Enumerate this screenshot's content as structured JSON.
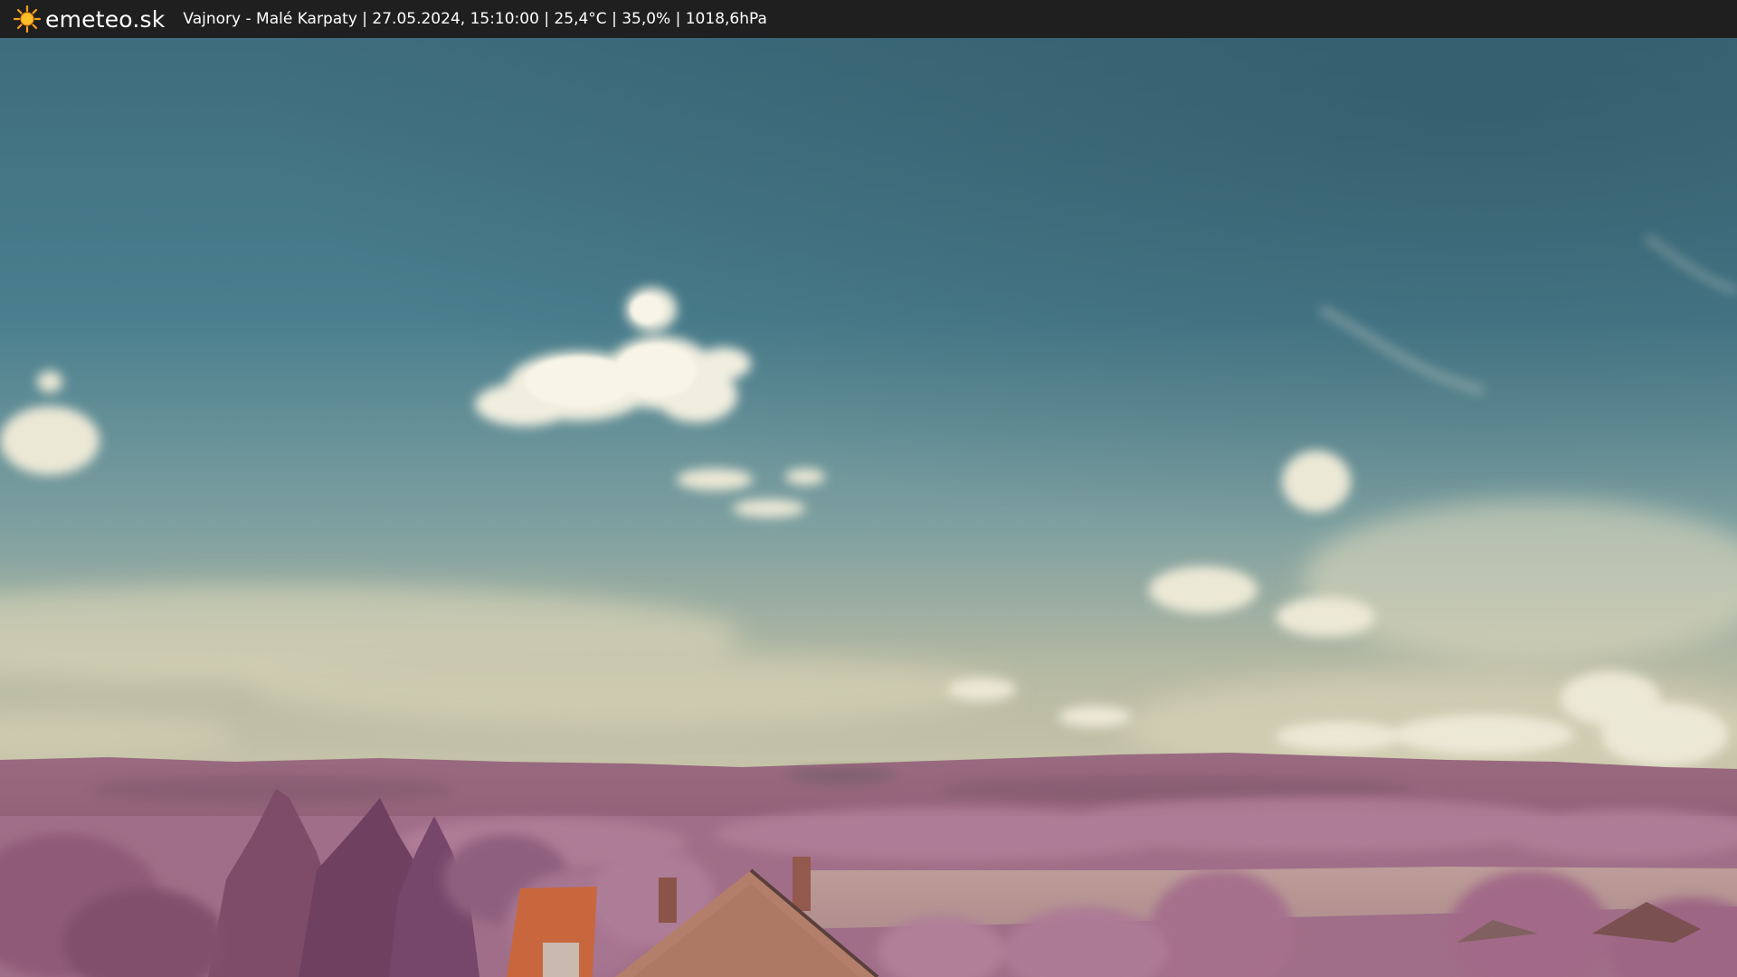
{
  "header": {
    "brand": "emeteo.sk",
    "brand_icon": "sun-icon",
    "info": "Vajnory - Malé Karpaty | 27.05.2024, 15:10:00 | 25,4°C | 35,0% | 1018,6hPa"
  },
  "colors": {
    "bar_background": "#1f1f1f",
    "sun": "#f6a21a",
    "sky_top": "#3a6878",
    "sky_horizon": "#c9c5a8",
    "foliage": "#a06a86"
  }
}
